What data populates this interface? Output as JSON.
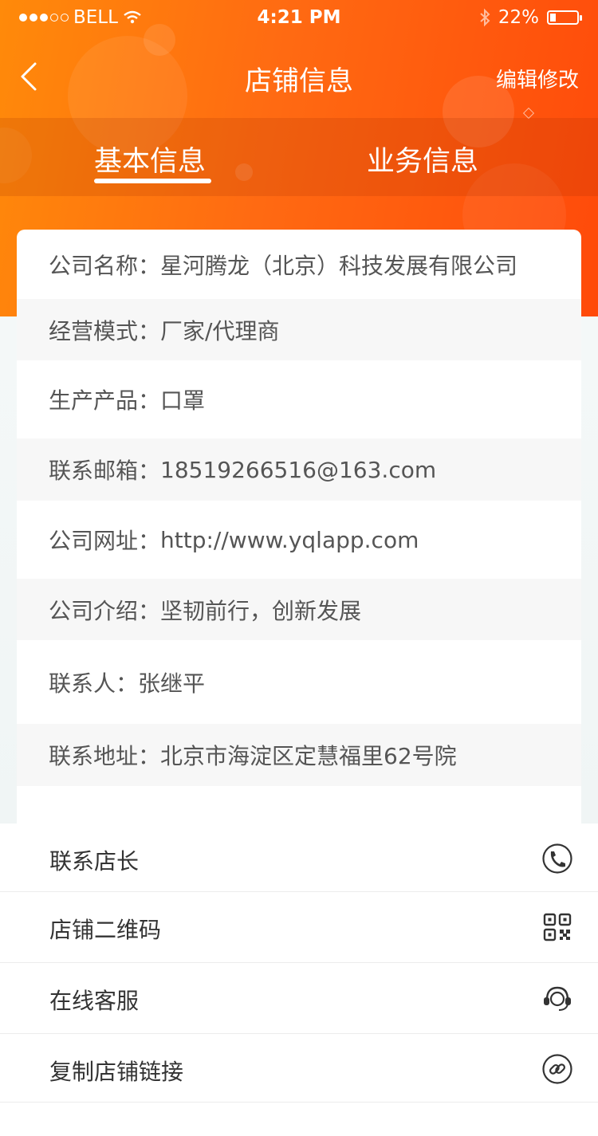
{
  "status_bar": {
    "carrier": "BELL",
    "time": "4:21 PM",
    "battery": "22%",
    "battery_level": 0.22,
    "signal_dots": 5,
    "signal_filled": 3
  },
  "nav": {
    "title": "店铺信息",
    "action": "编辑修改",
    "back_icon": "chevron-left-icon"
  },
  "tabs": [
    {
      "label": "基本信息",
      "active": true
    },
    {
      "label": "业务信息",
      "active": false
    }
  ],
  "info": [
    {
      "label": "公司名称：",
      "value": "星河腾龙（北京）科技发展有限公司"
    },
    {
      "label": "经营模式：",
      "value": "厂家/代理商"
    },
    {
      "label": "生产产品：",
      "value": "口罩"
    },
    {
      "label": "联系邮箱：",
      "value": "18519266516@163.com"
    },
    {
      "label": "公司网址：",
      "value": "http://www.yqlapp.com"
    },
    {
      "label": "公司介绍：",
      "value": "坚韧前行，创新发展"
    },
    {
      "label": "联系人：",
      "value": "张继平"
    },
    {
      "label": "联系地址：",
      "value": "北京市海淀区定慧福里62号院"
    }
  ],
  "menu": [
    {
      "label": "联系店长",
      "icon": "phone-icon"
    },
    {
      "label": "店铺二维码",
      "icon": "qr-code-icon"
    },
    {
      "label": "在线客服",
      "icon": "headset-icon"
    },
    {
      "label": "复制店铺链接",
      "icon": "link-icon"
    }
  ],
  "colors": {
    "brand_orange": "#ff6a12",
    "text_gray": "#555555"
  }
}
